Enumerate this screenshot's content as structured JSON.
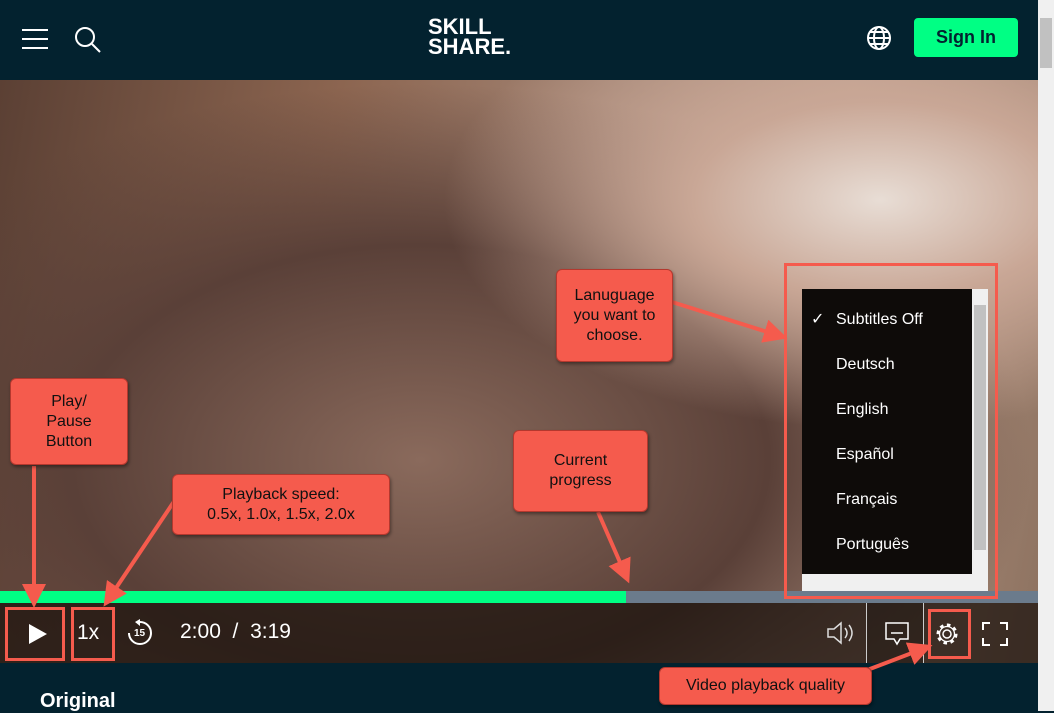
{
  "header": {
    "logo": "SKILL SHARE.",
    "sign_in": "Sign In"
  },
  "player": {
    "progress_percent": 60.3,
    "speed": "1x",
    "rewind_seconds": "15",
    "current_time": "2:00",
    "separator": "/",
    "duration": "3:19"
  },
  "subtitles_menu": {
    "items": [
      {
        "label": "Subtitles Off",
        "selected": true
      },
      {
        "label": "Deutsch"
      },
      {
        "label": "English"
      },
      {
        "label": "Español"
      },
      {
        "label": "Français"
      },
      {
        "label": "Português"
      }
    ],
    "check": "✓"
  },
  "annotations": {
    "play": "Play/ Pause Button",
    "speed": "Playback speed: 0.5x, 1.0x, 1.5x, 2.0x",
    "progress": "Current progress",
    "language": "Lanuguage you want to choose.",
    "quality": "Video playback quality"
  },
  "below": {
    "heading": "Original"
  },
  "colors": {
    "brand_green": "#00ff84",
    "navy": "#03222f",
    "callout": "#f55b4d"
  }
}
